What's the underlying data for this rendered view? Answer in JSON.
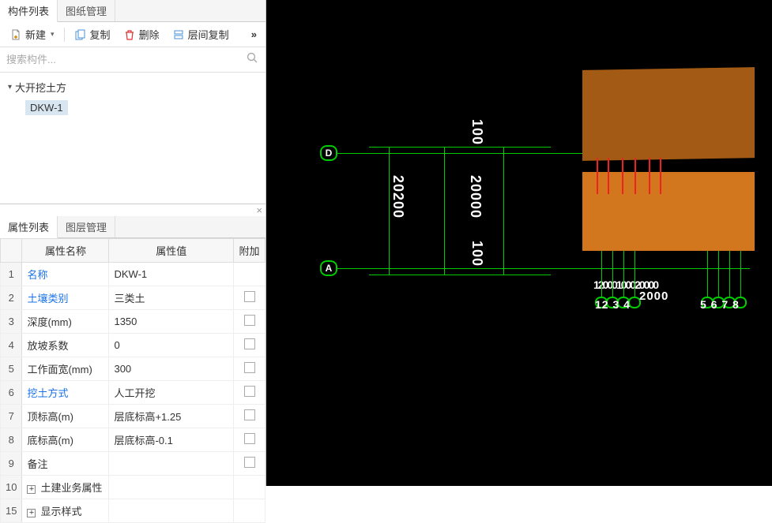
{
  "tabs": {
    "components": "构件列表",
    "drawings": "图纸管理"
  },
  "toolbar": {
    "new": "新建",
    "copy": "复制",
    "delete": "删除",
    "floor_copy": "层间复制",
    "more": "»"
  },
  "search": {
    "placeholder": "搜索构件..."
  },
  "tree": {
    "root": "大开挖土方",
    "item1": "DKW-1"
  },
  "prop_tabs": {
    "props": "属性列表",
    "layers": "图层管理"
  },
  "prop_header": {
    "name": "属性名称",
    "value": "属性值",
    "extra": "附加"
  },
  "props": [
    {
      "n": "1",
      "name": "名称",
      "link": true,
      "value": "DKW-1",
      "extra": ""
    },
    {
      "n": "2",
      "name": "土壤类别",
      "link": true,
      "value": "三类土",
      "extra": "cb"
    },
    {
      "n": "3",
      "name": "深度(mm)",
      "link": false,
      "value": "1350",
      "extra": "cb"
    },
    {
      "n": "4",
      "name": "放坡系数",
      "link": false,
      "value": "0",
      "extra": "cb"
    },
    {
      "n": "5",
      "name": "工作面宽(mm)",
      "link": false,
      "value": "300",
      "extra": "cb"
    },
    {
      "n": "6",
      "name": "挖土方式",
      "link": true,
      "value": "人工开挖",
      "extra": "cb"
    },
    {
      "n": "7",
      "name": "顶标高(m)",
      "link": false,
      "value": "层底标高+1.25",
      "extra": "cb"
    },
    {
      "n": "8",
      "name": "底标高(m)",
      "link": false,
      "value": "层底标高-0.1",
      "extra": "cb"
    },
    {
      "n": "9",
      "name": "备注",
      "link": false,
      "value": "",
      "extra": "cb"
    },
    {
      "n": "10",
      "name": "土建业务属性",
      "link": false,
      "value": "",
      "extra": "",
      "expand": true
    },
    {
      "n": "15",
      "name": "显示样式",
      "link": false,
      "value": "",
      "extra": "",
      "expand": true
    }
  ],
  "viewport": {
    "bubble_d": "D",
    "bubble_a": "A",
    "dim_100_top": "100",
    "dim_20200": "20200",
    "dim_20000": "20000",
    "dim_100_bot": "100",
    "axis_overlap1": "12000100020000",
    "axis_center": "2000",
    "axis_nums_left": "12 3 4",
    "axis_nums_right": "5 6 7 8"
  }
}
